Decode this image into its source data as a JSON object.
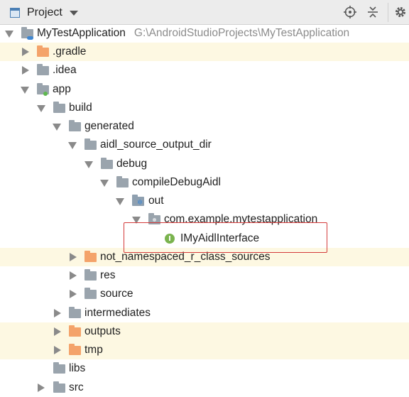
{
  "toolbar": {
    "title": "Project",
    "icons": [
      "project-view-icon",
      "dropdown-caret-icon",
      "locate-target-icon",
      "collapse-all-icon",
      "settings-gear-icon"
    ]
  },
  "tree": [
    {
      "label": "MyTestApplication",
      "path": "G:\\AndroidStudioProjects\\MyTestApplication",
      "icon": "module-folder-icon"
    },
    {
      "label": ".gradle",
      "icon": "orange-folder-icon"
    },
    {
      "label": ".idea",
      "icon": "folder-icon"
    },
    {
      "label": "app",
      "icon": "android-module-folder-icon"
    },
    {
      "label": "build",
      "icon": "folder-icon"
    },
    {
      "label": "generated",
      "icon": "folder-icon"
    },
    {
      "label": "aidl_source_output_dir",
      "icon": "folder-icon"
    },
    {
      "label": "debug",
      "icon": "folder-icon"
    },
    {
      "label": "compileDebugAidl",
      "icon": "folder-icon"
    },
    {
      "label": "out",
      "icon": "generated-sources-folder-icon"
    },
    {
      "label": "com.example.mytestapplication",
      "icon": "package-icon"
    },
    {
      "label": "IMyAidlInterface",
      "icon": "interface-icon",
      "icon_letter": "I"
    },
    {
      "label": "not_namespaced_r_class_sources",
      "icon": "orange-folder-icon"
    },
    {
      "label": "res",
      "icon": "folder-icon"
    },
    {
      "label": "source",
      "icon": "folder-icon"
    },
    {
      "label": "intermediates",
      "icon": "folder-icon"
    },
    {
      "label": "outputs",
      "icon": "orange-folder-icon"
    },
    {
      "label": "tmp",
      "icon": "orange-folder-icon"
    },
    {
      "label": "libs",
      "icon": "folder-icon"
    },
    {
      "label": "src",
      "icon": "folder-icon"
    }
  ],
  "colors": {
    "highlight_row": "#fdf8e2",
    "excluded_folder": "#f4a36a",
    "folder": "#9aa4ad",
    "interface_icon": "#7ab34e",
    "annotation_box": "#d33a3a"
  }
}
